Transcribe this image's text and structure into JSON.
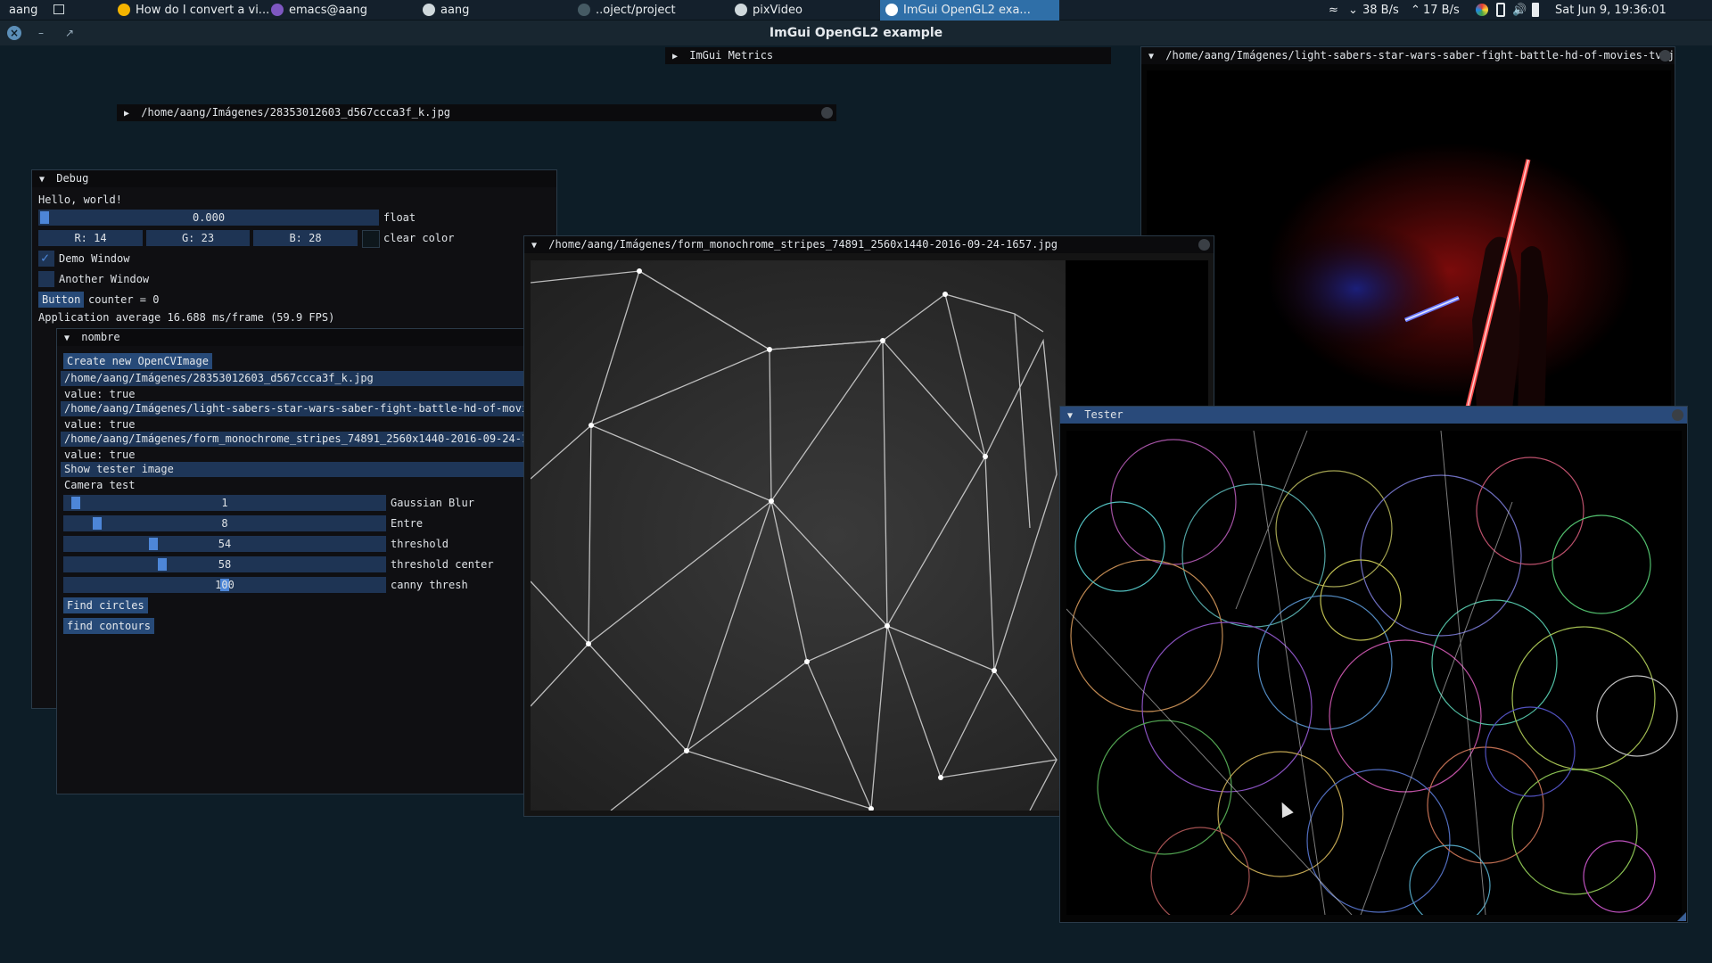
{
  "taskbar": {
    "workspace": "aang",
    "tasks": [
      {
        "label": "How do I convert a vi...",
        "icon": "chrome-icon",
        "color": "#f4b400"
      },
      {
        "label": "emacs@aang",
        "icon": "emacs-icon",
        "color": "#7e57c2"
      },
      {
        "label": "aang",
        "icon": "home-icon",
        "color": "#cfd8dc"
      },
      {
        "label": "..oject/project",
        "icon": "terminal-icon",
        "color": "#455a64"
      },
      {
        "label": "pixVideo",
        "icon": "folder-icon",
        "color": "#cfd8dc"
      },
      {
        "label": "ImGui OpenGL2 exa...",
        "icon": "window-icon",
        "color": "#ffffff"
      }
    ],
    "net_down": "38 B/s",
    "net_up": "17 B/s",
    "clock": "Sat Jun 9, 19:36:01"
  },
  "window_title": "ImGui OpenGL2 example",
  "metrics": {
    "title": "ImGui Metrics"
  },
  "collapsed_image": {
    "title": "/home/aang/Imágenes/28353012603_d567ccca3f_k.jpg"
  },
  "debug": {
    "title": "Debug",
    "hello": "Hello, world!",
    "float_value": "0.000",
    "float_fraction": 0.0,
    "float_label": "float",
    "r": "R: 14",
    "g": "G: 23",
    "b": "B: 28",
    "clear_color_label": "clear color",
    "clear_color": "#0e171c",
    "demo_window": "Demo Window",
    "demo_checked": true,
    "another_window": "Another Window",
    "another_checked": false,
    "button": "Button",
    "counter": "counter = 0",
    "fps": "Application average 16.688 ms/frame (59.9 FPS)"
  },
  "nombre": {
    "title": "nombre",
    "create_btn": "Create new OpenCVImage",
    "images": [
      {
        "path": "/home/aang/Imágenes/28353012603_d567ccca3f_k.jpg",
        "value": "value: true"
      },
      {
        "path": "/home/aang/Imágenes/light-sabers-star-wars-saber-fight-battle-hd-of-movies-tv.jpg",
        "value": "value: true"
      },
      {
        "path": "/home/aang/Imágenes/form_monochrome_stripes_74891_2560x1440-2016-09-24-1657.jpg",
        "value": "value: true"
      }
    ],
    "show_tester": "Show tester image",
    "camera_test": "Camera test",
    "sliders": [
      {
        "label": "Gaussian Blur",
        "value": "1",
        "fraction": 0.02
      },
      {
        "label": "Entre",
        "value": "8",
        "fraction": 0.09
      },
      {
        "label": "threshold",
        "value": "54",
        "fraction": 0.27
      },
      {
        "label": "threshold center",
        "value": "58",
        "fraction": 0.3
      },
      {
        "label": "canny thresh",
        "value": "100",
        "fraction": 0.5
      }
    ],
    "find_circles": "Find circles",
    "find_contours": "find contours"
  },
  "stripes_win": {
    "title": "/home/aang/Imágenes/form_monochrome_stripes_74891_2560x1440-2016-09-24-1657.jpg"
  },
  "sabers_win": {
    "title": "/home/aang/Imágenes/light-sabers-star-wars-saber-fight-battle-hd-of-movies-tv.jpg"
  },
  "tester_win": {
    "title": "Tester"
  }
}
